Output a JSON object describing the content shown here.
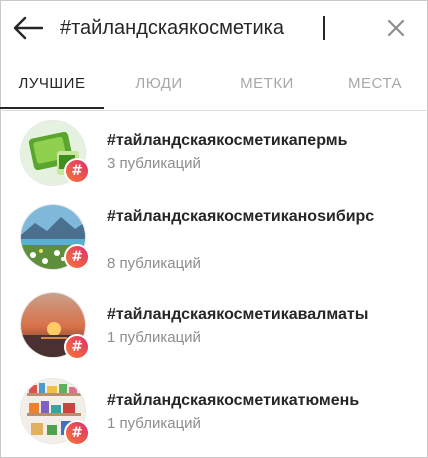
{
  "search": {
    "query": "#тайландскаякосметика"
  },
  "tabs": [
    {
      "label": "ЛУЧШИЕ"
    },
    {
      "label": "ЛЮДИ"
    },
    {
      "label": "МЕТКИ"
    },
    {
      "label": "МЕСТА"
    }
  ],
  "active_tab": "ЛУЧШИЕ",
  "badge_symbol": "#",
  "colors": {
    "badge_gradient_start": "#f77737",
    "badge_gradient_end": "#e1306c",
    "text_primary": "#262626",
    "text_secondary": "#8e8e8e"
  },
  "results": [
    {
      "tag": "#тайландскаякосметикапермь",
      "posts": "3 публикаций"
    },
    {
      "tag": "#тайландскаякосметиканоsибирс",
      "posts": "8 публикаций"
    },
    {
      "tag": "#тайландскаякосметикавалматы",
      "posts": "1 публикаций"
    },
    {
      "tag": "#тайландскаякосметикатюмень",
      "posts": "1 публикаций"
    }
  ]
}
